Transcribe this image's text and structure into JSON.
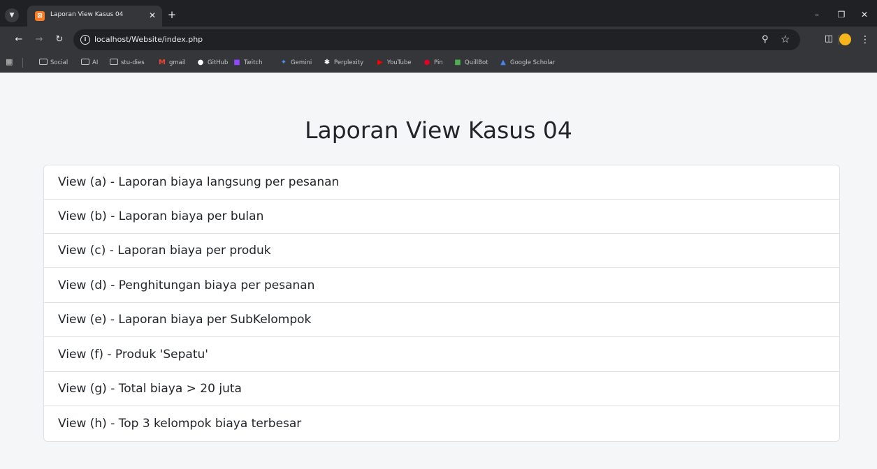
{
  "browser": {
    "tab_title": "Laporan View Kasus 04",
    "url": "localhost/Website/index.php",
    "icons": {
      "tab_favicon": "xampp-icon",
      "back": "arrow-left-icon",
      "forward": "arrow-right-icon",
      "reload": "reload-icon",
      "info": "info-icon",
      "zoom": "zoom-icon",
      "bookmark_star": "star-icon",
      "extensions": "puzzle-icon",
      "profile": "avatar",
      "menu": "kebab-menu-icon"
    },
    "bookmarks": [
      {
        "label": "Social",
        "icon": "folder-icon"
      },
      {
        "label": "AI",
        "icon": "folder-icon"
      },
      {
        "label": "stu-dies",
        "icon": "folder-icon"
      },
      {
        "label": "gmail",
        "icon": "gmail-icon"
      },
      {
        "label": "GitHub",
        "icon": "github-icon"
      },
      {
        "label": "Twitch",
        "icon": "twitch-icon"
      },
      {
        "label": "Gemini",
        "icon": "gemini-icon"
      },
      {
        "label": "Perplexity",
        "icon": "perplexity-icon"
      },
      {
        "label": "YouTube",
        "icon": "youtube-icon"
      },
      {
        "label": "Pin",
        "icon": "pinterest-icon"
      },
      {
        "label": "QuillBot",
        "icon": "quillbot-icon"
      },
      {
        "label": "Google Scholar",
        "icon": "google-scholar-icon"
      }
    ]
  },
  "page": {
    "title": "Laporan View Kasus 04",
    "items": [
      {
        "label": "View (a) - Laporan biaya langsung per pesanan"
      },
      {
        "label": "View (b) - Laporan biaya per bulan"
      },
      {
        "label": "View (c) - Laporan biaya per produk"
      },
      {
        "label": "View (d) - Penghitungan biaya per pesanan"
      },
      {
        "label": "View (e) - Laporan biaya per SubKelompok"
      },
      {
        "label": "View (f) - Produk 'Sepatu'"
      },
      {
        "label": "View (g) - Total biaya > 20 juta"
      },
      {
        "label": "View (h) - Top 3 kelompok biaya terbesar"
      }
    ]
  },
  "colors": {
    "chrome_dark": "#202124",
    "chrome_toolbar": "#35363a",
    "page_background": "#f5f6f8",
    "list_border": "#dee2e6",
    "text": "#212529"
  }
}
